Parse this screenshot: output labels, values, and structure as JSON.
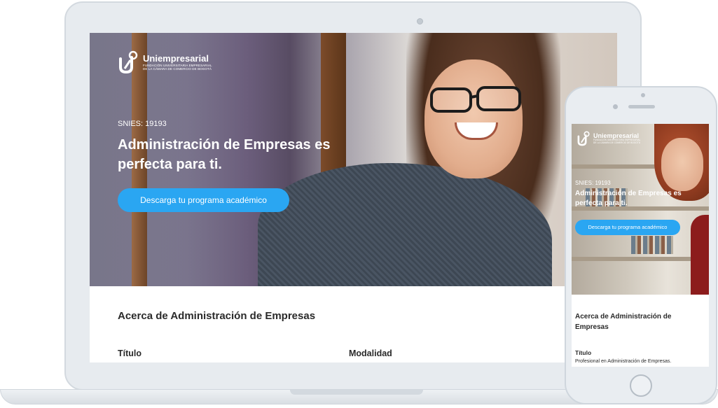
{
  "brand": {
    "name": "Uniempresarial",
    "subtitle_line1": "FUNDACIÓN UNIVERSITARIA EMPRESARIAL",
    "subtitle_line2": "DE LA CÁMARA DE COMERCIO DE BOGOTÁ"
  },
  "hero": {
    "snies": "SNIES: 19193",
    "title": "Administración de Empresas es perfecta para ti.",
    "cta_label": "Descarga tu programa académico"
  },
  "about": {
    "title": "Acerca de Administración de Empresas",
    "col_titulo_label": "Título",
    "col_modalidad_label": "Modalidad",
    "titulo_value": "Profesional en Administración de Empresas."
  },
  "colors": {
    "accent": "#2aa6f2",
    "text_dark": "#2a2a2a",
    "device_frame": "#e7ebef"
  },
  "icons": {
    "logo": "uniempresarial-logo-icon"
  }
}
